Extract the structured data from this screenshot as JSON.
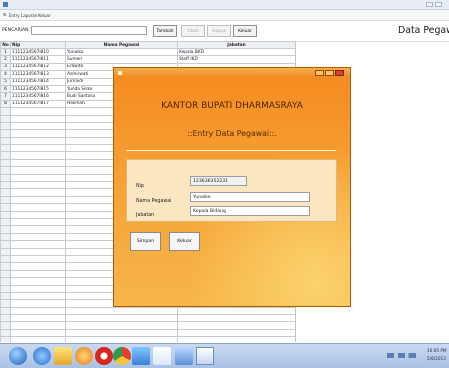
{
  "window": {
    "menu": [
      "Entry",
      "Laporan",
      "Keluar"
    ]
  },
  "toolbar": {
    "search_label": "PENCARIAN :",
    "search_value": "",
    "buttons": [
      {
        "label": "Tambah",
        "enabled": true
      },
      {
        "label": "Ubah",
        "enabled": false
      },
      {
        "label": "Hapus",
        "enabled": false
      },
      {
        "label": "Keluar",
        "enabled": true
      }
    ],
    "page_title": "Data Pegawa"
  },
  "grid": {
    "headers": [
      "No",
      "Nip",
      "Nama Pegawai",
      "Jabatan"
    ],
    "rows": [
      [
        "1",
        "1111234567I810",
        "Yunaiko",
        "Kepala BKD"
      ],
      [
        "2",
        "1111234567I811",
        "Sumeri",
        "Staff IKD"
      ],
      [
        "3",
        "1111234567I812",
        "Erawita",
        ""
      ],
      [
        "4",
        "1111234567I813",
        "Asmirwati",
        ""
      ],
      [
        "5",
        "1111234567I814",
        "Jurnaidi",
        ""
      ],
      [
        "6",
        "1111234567I815",
        "Yunda Sisko",
        ""
      ],
      [
        "7",
        "1111234567I816",
        "Budi Santoso",
        ""
      ],
      [
        "8",
        "1111234567I817",
        "Halimah",
        ""
      ]
    ]
  },
  "dialog": {
    "heading": "KANTOR BUPATI DHARMASRAYA",
    "subheading": "::Entry Data Pegawai::.",
    "fields": [
      {
        "label": "Nip",
        "value": "123636352231"
      },
      {
        "label": "Nama Pegawai",
        "value": "Yunaiko"
      },
      {
        "label": "Jabatan",
        "value": "Kepala Bidang"
      }
    ],
    "buttons": [
      "Simpan",
      "Keluar"
    ]
  },
  "taskbar": {
    "time": "10:05 PM",
    "date": "5/8/2013"
  },
  "colors": {
    "dialog_orange": "#f4a637",
    "taskbar": "#b8cdea"
  }
}
